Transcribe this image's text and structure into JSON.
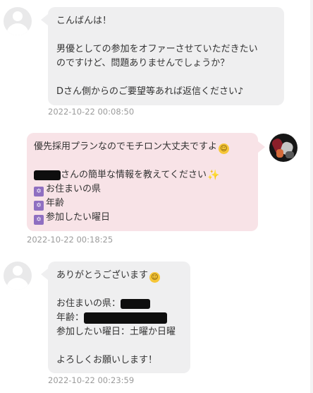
{
  "messages": [
    {
      "lines": [
        "こんばんは！",
        "",
        "男優としての参加をオファーさせていただきたい",
        "のですけど、問題ありませんでしょうか？",
        "",
        "Dさん側からのご要望等あれば返信ください♪"
      ],
      "timestamp": "2022-10-22 00:08:50"
    },
    {
      "line1": "優先採用プランなのでモチロン大丈夫ですよ",
      "line2": "さんの簡単な情報を教えてください",
      "items": [
        "お住まいの県",
        "年齢",
        "参加したい曜日"
      ],
      "timestamp": "2022-10-22 00:18:25"
    },
    {
      "line1": "ありがとうございます",
      "prefecture_label": "お住まいの県：",
      "age_label": "年齢：",
      "day_line": "参加したい曜日：土曜か日曜",
      "closing": "よろしくお願いします！",
      "timestamp": "2022-10-22 00:23:59"
    }
  ],
  "icons": {
    "smile": "smiling-face-icon",
    "sparkle": "sparkles-icon",
    "star": "star-of-david-icon"
  },
  "colors": {
    "gray_bubble": "#efeff0",
    "pink_bubble": "#f8e3e7",
    "timestamp": "#9b9b9b"
  }
}
